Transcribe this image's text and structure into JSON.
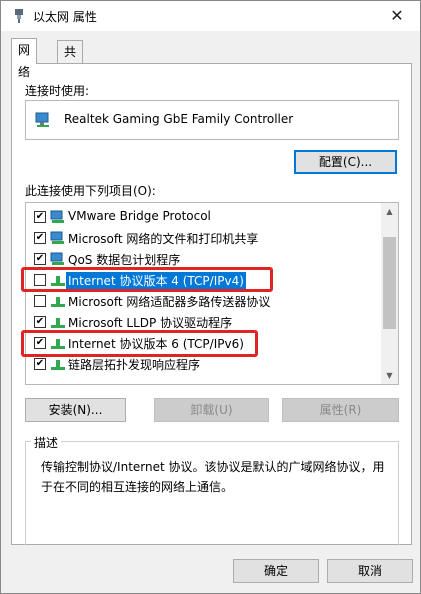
{
  "window": {
    "title": "以太网 属性",
    "close_symbol": "✕"
  },
  "tabs": [
    {
      "label": "网络",
      "active": true
    },
    {
      "label": "共享",
      "active": false
    }
  ],
  "connect_using": {
    "label": "连接时使用:",
    "device": "Realtek Gaming GbE Family Controller",
    "configure_button": "配置(C)..."
  },
  "items_section": {
    "label": "此连接使用下列项目(O):",
    "items": [
      {
        "label": "VMware Bridge Protocol",
        "checked": true,
        "icon": "network-client-icon"
      },
      {
        "label": "Microsoft 网络的文件和打印机共享",
        "checked": true,
        "icon": "network-client-icon"
      },
      {
        "label": "QoS 数据包计划程序",
        "checked": true,
        "icon": "network-client-icon"
      },
      {
        "label": "Internet 协议版本 4 (TCP/IPv4)",
        "checked": false,
        "selected": true,
        "icon": "protocol-icon"
      },
      {
        "label": "Microsoft 网络适配器多路传送器协议",
        "checked": false,
        "icon": "protocol-icon"
      },
      {
        "label": "Microsoft LLDP 协议驱动程序",
        "checked": true,
        "icon": "protocol-icon"
      },
      {
        "label": "Internet 协议版本 6 (TCP/IPv6)",
        "checked": true,
        "icon": "protocol-icon"
      },
      {
        "label": "链路层拓扑发现响应程序",
        "checked": true,
        "icon": "protocol-icon"
      }
    ]
  },
  "actions": {
    "install": "安装(N)...",
    "uninstall": "卸载(U)",
    "properties": "属性(R)"
  },
  "description": {
    "title": "描述",
    "text": "传输控制协议/Internet 协议。该协议是默认的广域网络协议，用于在不同的相互连接的网络上通信。"
  },
  "footer": {
    "ok": "确定",
    "cancel": "取消"
  },
  "colors": {
    "accent": "#0078d7",
    "highlight_box": "#e02424"
  }
}
